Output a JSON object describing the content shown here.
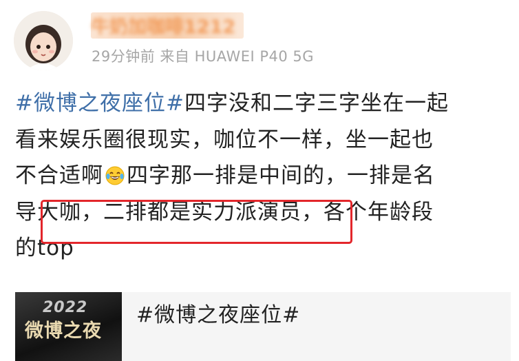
{
  "header": {
    "username": "牛奶加咖啡1212",
    "meta": "29分钟前  来自 HUAWEI P40 5G"
  },
  "post": {
    "lines": [
      {
        "topic": "#微博之夜座位#",
        "text": "四字没和二字三字坐在一起"
      },
      {
        "text": "看来娱乐圈很现实，咖位不一样，坐一起也"
      },
      {
        "before_emoji": "不合适啊",
        "emoji": "laughing-tears-emoji",
        "after_emoji": "四字那一排是中间的，一排是名"
      },
      {
        "text": "导大咖，二排都是实力派演员，各个年龄段"
      },
      {
        "text": "的top"
      }
    ]
  },
  "card": {
    "thumb_year": "2022",
    "thumb_logo": "微博之夜",
    "title": "#微博之夜座位#"
  },
  "colors": {
    "topic": "#3f6fa8",
    "username": "#f08a3e",
    "highlight": "#e3262b",
    "meta": "#a6a6a6"
  }
}
